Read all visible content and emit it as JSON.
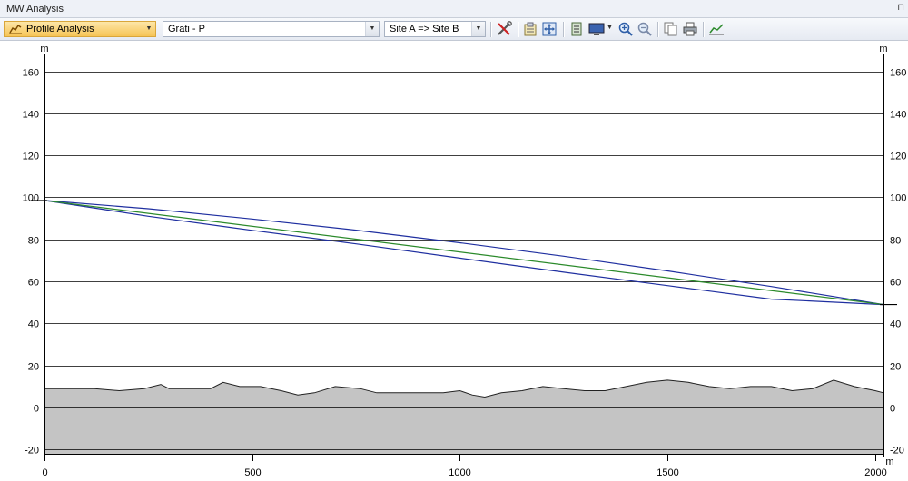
{
  "window": {
    "title": "MW Analysis",
    "pin_glyph": "⊓"
  },
  "toolbar": {
    "mode": "Profile Analysis",
    "link": "Grati - P",
    "direction": "Site A => Site B",
    "icons": [
      "tools-icon",
      "properties-icon",
      "fit-icon",
      "layers-icon",
      "display-icon",
      "zoom-in-icon",
      "zoom-out-icon",
      "copy-icon",
      "print-icon",
      "chart-icon"
    ]
  },
  "chart_data": {
    "type": "line",
    "title": "",
    "y_unit_left": "m",
    "y_unit_right": "m",
    "x_unit": "m",
    "xlim": [
      0,
      2020
    ],
    "ylim": [
      -22,
      168
    ],
    "x_ticks": [
      0,
      500,
      1000,
      1500,
      2000
    ],
    "x_tick_labels": [
      "0",
      "500",
      "1000",
      "1500",
      "2000"
    ],
    "y_ticks": [
      -20,
      0,
      20,
      40,
      60,
      80,
      100,
      120,
      140,
      160
    ],
    "y_tick_labels": [
      "-20",
      "0",
      "20",
      "40",
      "60",
      "80",
      "100",
      "120",
      "140",
      "160"
    ],
    "grid": "horizontal",
    "colors": {
      "los": "#2b8a2b",
      "fresnel": "#1f2fa0",
      "terrain_fill": "#c4c4c4",
      "terrain_line": "#222222"
    },
    "series": [
      {
        "type": "line",
        "x": [
          0,
          2020
        ],
        "y": [
          98.5,
          49
        ]
      },
      {
        "type": "fresnel",
        "x": [
          0,
          250,
          500,
          750,
          1000,
          1250,
          1500,
          1750,
          2020
        ],
        "y_upper": [
          98.5,
          94.6,
          89.7,
          84.4,
          78.4,
          72.0,
          65.0,
          57.6,
          49
        ],
        "y_lower": [
          98.5,
          91.0,
          84.3,
          77.9,
          71.1,
          64.4,
          58.0,
          51.6,
          49
        ]
      },
      {
        "type": "terrain",
        "x": [
          0,
          60,
          120,
          180,
          240,
          280,
          300,
          350,
          400,
          430,
          470,
          520,
          570,
          610,
          650,
          700,
          760,
          800,
          850,
          900,
          960,
          1000,
          1030,
          1060,
          1100,
          1150,
          1200,
          1250,
          1300,
          1350,
          1400,
          1450,
          1500,
          1550,
          1600,
          1650,
          1700,
          1750,
          1800,
          1850,
          1900,
          1950,
          2000,
          2020
        ],
        "y": [
          9,
          9,
          9,
          8,
          9,
          11,
          9,
          9,
          9,
          12,
          10,
          10,
          8,
          6,
          7,
          10,
          9,
          7,
          7,
          7,
          7,
          8,
          6,
          5,
          7,
          8,
          10,
          9,
          8,
          8,
          10,
          12,
          13,
          12,
          10,
          9,
          10,
          10,
          8,
          9,
          13,
          10,
          8,
          7
        ]
      }
    ]
  }
}
